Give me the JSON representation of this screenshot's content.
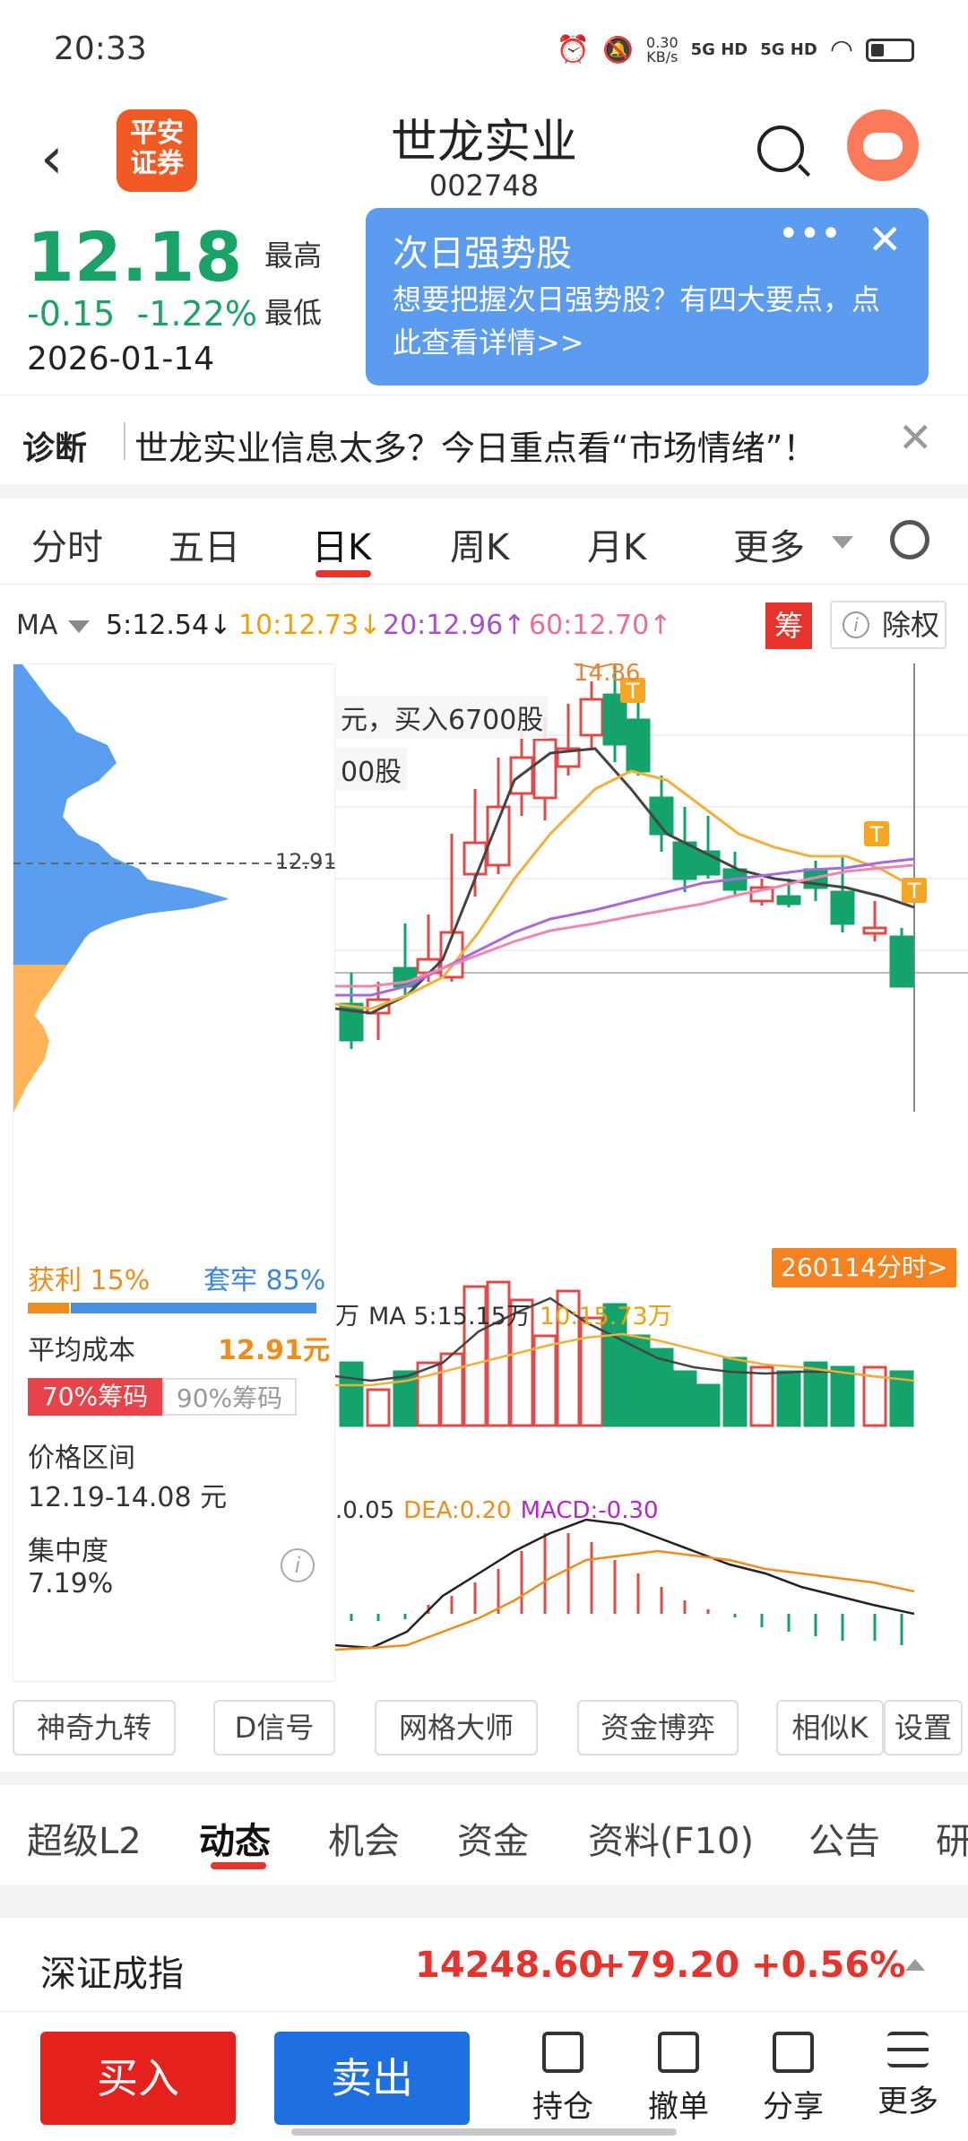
{
  "status_bar": {
    "time": "20:33",
    "net_speed": "0.30",
    "net_unit": "KB/s",
    "signal1": "5G HD",
    "signal2": "5G HD"
  },
  "header": {
    "logo": "平安\n证券",
    "stock_name": "世龙实业",
    "stock_code": "002748"
  },
  "quote": {
    "price": "12.18",
    "change": "-0.15",
    "change_pct": "-1.22%",
    "date": "2026-01-14",
    "high_label": "最高",
    "low_label": "最低"
  },
  "popup": {
    "title": "次日强势股",
    "body": "想要把握次日强势股？有四大要点，点此查看详情>>",
    "dots": "•••",
    "close": "✕"
  },
  "diagnosis": {
    "label": "诊断",
    "text": "世龙实业信息太多？今日重点看“市场情绪”！",
    "close": "✕"
  },
  "period_tabs": [
    "分时",
    "五日",
    "日K",
    "周K",
    "月K",
    "更多"
  ],
  "period_active": "日K",
  "ma": {
    "label": "MA",
    "items": [
      {
        "text": "5:12.54↓",
        "color": "#222222"
      },
      {
        "text": "10:12.73↓",
        "color": "#f0a000"
      },
      {
        "text": "20:12.96↑",
        "color": "#a84fd0"
      },
      {
        "text": "60:12.70↑",
        "color": "#ef6a9a"
      }
    ],
    "chou": "筹",
    "chuquan": "除权"
  },
  "chip": {
    "price_line": "12.91",
    "profit_label": "获利",
    "profit_pct": "15%",
    "trapped_label": "套牢",
    "trapped_pct": "85%",
    "profit_fraction": 0.15,
    "avg_cost_label": "平均成本",
    "avg_cost": "12.91元",
    "tab70": "70%筹码",
    "tab90": "90%筹码",
    "range_label": "价格区间",
    "range": "12.19-14.08 元",
    "concentration_label": "集中度",
    "concentration": "7.19%",
    "info": "i"
  },
  "chart": {
    "annotation1": "元，买入6700股",
    "annotation2": "00股",
    "high_marker": "14.86",
    "t_marker": "T",
    "intraday_btn": "260114分时>",
    "vol_legend_prefix": "万",
    "vol_ma5": "MA 5:15.15万",
    "vol_ma10": "10:15.73万",
    "macd_dif": ".0.05",
    "macd_dea": "DEA:0.20",
    "macd_macd": "MACD:-0.30",
    "colors": {
      "up": "#e24a4a",
      "down": "#14a36a",
      "ma5": "#444444",
      "ma10": "#f0b03a",
      "ma20": "#a86ad8",
      "ma60": "#ef85b2"
    }
  },
  "tools": [
    "神奇九转",
    "D信号",
    "网格大师",
    "资金博弈",
    "相似K",
    "设置"
  ],
  "bottom_tabs": [
    "超级L2",
    "动态",
    "机会",
    "资金",
    "资料(F10)",
    "公告",
    "研"
  ],
  "bottom_active": "动态",
  "index_bar": {
    "name": "深证成指",
    "value": "14248.60",
    "change": "+79.20",
    "pct": "+0.56%"
  },
  "actions": {
    "buy": "买入",
    "sell": "卖出",
    "items": [
      "持仓",
      "撤单",
      "分享",
      "更多"
    ]
  }
}
